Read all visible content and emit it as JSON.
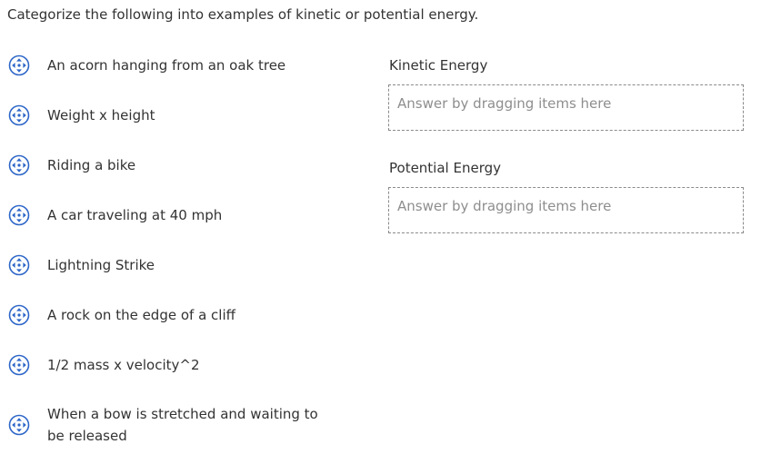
{
  "prompt": "Categorize the following into examples of kinetic or potential energy.",
  "items": [
    {
      "label": "An acorn hanging from an oak tree"
    },
    {
      "label": "Weight x height"
    },
    {
      "label": "Riding a bike"
    },
    {
      "label": "A car traveling at 40 mph"
    },
    {
      "label": "Lightning Strike"
    },
    {
      "label": "A rock on the edge of a cliff"
    },
    {
      "label": "1/2 mass x velocity^2"
    },
    {
      "label": "When a bow is stretched and waiting to be released"
    }
  ],
  "zones": [
    {
      "title": "Kinetic Energy",
      "placeholder": "Answer by dragging items here"
    },
    {
      "title": "Potential Energy",
      "placeholder": "Answer by dragging items here"
    }
  ],
  "colors": {
    "handle_blue": "#2d66c8",
    "text": "#333333",
    "placeholder": "#8e8e8e",
    "dashed_border": "#8a8a8a"
  },
  "icons": {
    "drag_handle": "move-arrows-icon"
  }
}
